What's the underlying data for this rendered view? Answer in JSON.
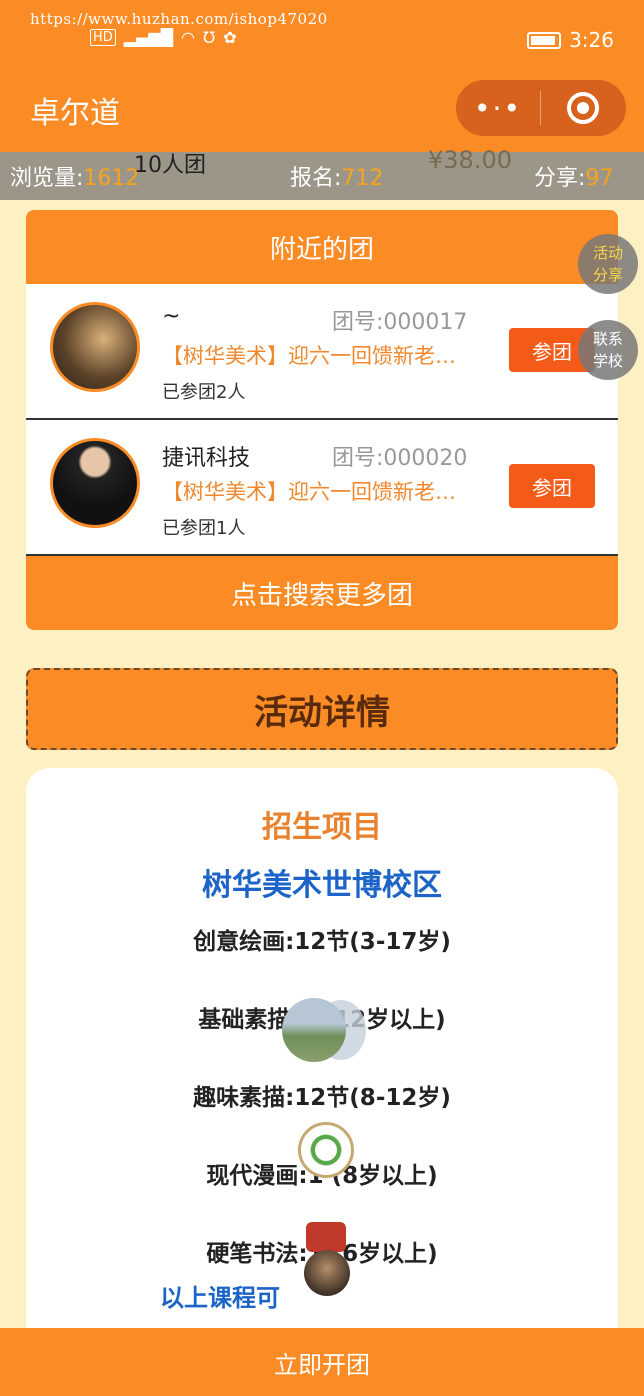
{
  "watermark": "https://www.huzhan.com/ishop47020",
  "status": {
    "time": "3:26",
    "network": "HD 4G",
    "icons": [
      "hd-icon",
      "signal-icon",
      "wifi-icon",
      "usb-icon",
      "wechat-icon",
      "battery-icon"
    ]
  },
  "app": {
    "title": "卓尔道",
    "more_glyph": "•·•"
  },
  "overlay": {
    "group_title": "10人团",
    "price": "¥38.00"
  },
  "stats": {
    "views_label": "浏览量:",
    "views": "1612",
    "signup_label": "报名:",
    "signup": "712",
    "share_label": "分享:",
    "share": "97"
  },
  "nearby": {
    "header": "附近的团",
    "groups": [
      {
        "name": "~",
        "id": "团号:000017",
        "desc": "【树华美术】迎六一回馈新老…",
        "count": "已参团2人",
        "join": "参团"
      },
      {
        "name": "捷讯科技",
        "id": "团号:000020",
        "desc": "【树华美术】迎六一回馈新老…",
        "count": "已参团1人",
        "join": "参团"
      }
    ],
    "search_more": "点击搜索更多团"
  },
  "float": {
    "share_l1": "活动",
    "share_l2": "分享",
    "contact_l1": "联系",
    "contact_l2": "学校"
  },
  "detail": {
    "header": "活动详情",
    "title": "招生项目",
    "school": "树华美术世博校区",
    "courses": [
      "创意绘画:12节(3-17岁)",
      "基础素描:1    (12岁以上)",
      "趣味素描:12节(8-12岁)",
      "现代漫画:1    (8岁以上)",
      "硬笔书法:1    (6岁以上)"
    ],
    "note": "以上课程可"
  },
  "bottom": {
    "label": "立即开团"
  },
  "colors": {
    "primary": "#fb8b24",
    "accent_orange": "#f55b18",
    "blue": "#1d64c9",
    "bg": "#fdf1c4"
  }
}
